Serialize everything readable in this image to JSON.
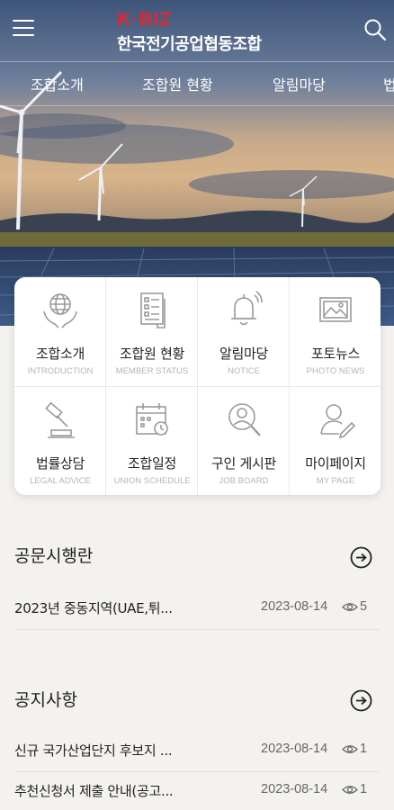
{
  "header": {
    "logo_brand": "K·BIZ",
    "org_name": "한국전기공업협동조합",
    "menu_icon": "hamburger-menu-icon",
    "search_icon": "search-icon"
  },
  "nav": {
    "items": [
      "조합소개",
      "조합원 현황",
      "알림마당",
      "법"
    ]
  },
  "grid": {
    "tiles": [
      {
        "label": "조합소개",
        "sub": "INTRODUCTION",
        "icon": "globe-hands-icon"
      },
      {
        "label": "조합원 현황",
        "sub": "MEMBER STATUS",
        "icon": "document-list-icon"
      },
      {
        "label": "알림마당",
        "sub": "NOTICE",
        "icon": "bell-icon"
      },
      {
        "label": "포토뉴스",
        "sub": "PHOTO NEWS",
        "icon": "photo-icon"
      },
      {
        "label": "법률상담",
        "sub": "LEGAL ADVICE",
        "icon": "gavel-icon"
      },
      {
        "label": "조합일정",
        "sub": "UNION SCHEDULE",
        "icon": "calendar-icon"
      },
      {
        "label": "구인 게시판",
        "sub": "JOB BOARD",
        "icon": "person-search-icon"
      },
      {
        "label": "마이페이지",
        "sub": "MY PAGE",
        "icon": "user-edit-icon"
      }
    ]
  },
  "sections": {
    "official": {
      "title": "공문시행란",
      "rows": [
        {
          "title": "2023년 중동지역(UAE,튀...",
          "date": "2023-08-14",
          "views": "5"
        }
      ]
    },
    "notice": {
      "title": "공지사항",
      "rows": [
        {
          "title": "신규 국가산업단지 후보지 ...",
          "date": "2023-08-14",
          "views": "1"
        },
        {
          "title": "추천신청서 제출 안내(공고...",
          "date": "2023-08-14",
          "views": "1"
        }
      ]
    }
  },
  "colors": {
    "brand_red": "#e3262e",
    "icon_gray": "#9a9a9a"
  }
}
